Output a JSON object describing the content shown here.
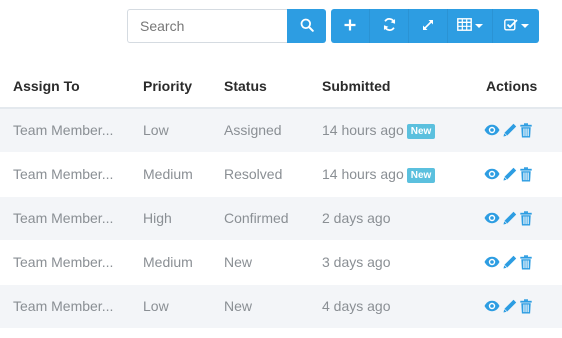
{
  "toolbar": {
    "search_placeholder": "Search",
    "icons": [
      "search-icon",
      "plus-icon",
      "refresh-icon",
      "expand-icon",
      "columns-icon",
      "checklist-icon"
    ]
  },
  "colors": {
    "accent": "#2d9de2",
    "badge": "#5bc0de",
    "row_stripe": "#f3f5f8"
  },
  "table": {
    "headers": [
      "Assign To",
      "Priority",
      "Status",
      "Submitted",
      "Actions"
    ],
    "rows": [
      {
        "assign": "Team Member...",
        "priority": "Low",
        "status": "Assigned",
        "submitted": "14 hours ago",
        "badge": "New"
      },
      {
        "assign": "Team Member...",
        "priority": "Medium",
        "status": "Resolved",
        "submitted": "14 hours ago",
        "badge": "New"
      },
      {
        "assign": "Team Member...",
        "priority": "High",
        "status": "Confirmed",
        "submitted": "2 days ago",
        "badge": ""
      },
      {
        "assign": "Team Member...",
        "priority": "Medium",
        "status": "New",
        "submitted": "3 days ago",
        "badge": ""
      },
      {
        "assign": "Team Member...",
        "priority": "Low",
        "status": "New",
        "submitted": "4 days ago",
        "badge": ""
      }
    ]
  }
}
